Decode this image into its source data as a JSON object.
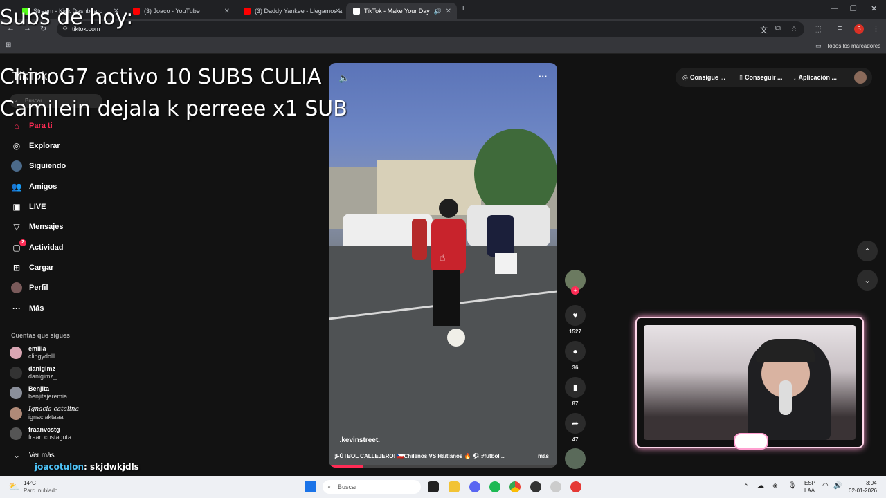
{
  "browser": {
    "tabs": [
      {
        "label": "Stream - Kick Dashboard",
        "favicon_color": "#53fc18"
      },
      {
        "label": "(3) Joaco - YouTube",
        "favicon_color": "#ff0000"
      },
      {
        "label": "(3) Daddy Yankee - Llegamos a",
        "favicon_color": "#ff0000"
      },
      {
        "label": "TikTok - Make Your Day",
        "favicon_color": "#ffffff"
      }
    ],
    "url": "tiktok.com",
    "bookmarks_folder": "Todos los marcadores",
    "profile_initial": "B"
  },
  "tiktok": {
    "logo": "TikTok",
    "search_placeholder": "Buscar",
    "nav": [
      {
        "label": "Para ti",
        "icon": "home-icon"
      },
      {
        "label": "Explorar",
        "icon": "compass-icon"
      },
      {
        "label": "Siguiendo",
        "icon": "following-icon"
      },
      {
        "label": "Amigos",
        "icon": "friends-icon"
      },
      {
        "label": "LIVE",
        "icon": "live-icon"
      },
      {
        "label": "Mensajes",
        "icon": "messages-icon"
      },
      {
        "label": "Actividad",
        "icon": "activity-icon",
        "badge": "2"
      },
      {
        "label": "Cargar",
        "icon": "upload-icon"
      },
      {
        "label": "Perfil",
        "icon": "profile-icon"
      },
      {
        "label": "Más",
        "icon": "more-icon"
      }
    ],
    "following_title": "Cuentas que sigues",
    "following": [
      {
        "user": "emilia",
        "handle": "clingydolll"
      },
      {
        "user": "danigimz_",
        "handle": "danigimz_"
      },
      {
        "user": "Benjita",
        "handle": "benjitajeremia"
      },
      {
        "user": "Ignacia catalina",
        "handle": "ignaciaktaaa"
      },
      {
        "user": "fraanvcstg",
        "handle": "fraan.costaguta"
      }
    ],
    "see_more": "Ver más",
    "top_buttons": [
      "Consigue ...",
      "Conseguir ...",
      "Aplicación ..."
    ],
    "video": {
      "author": "_.kevinstreet._",
      "description": "¡FÚTBOL CALLEJERO! 🇨🇱Chilenos VS Haitianos 🔥 ⚽ #futbol ...",
      "more": "más",
      "progress": 0.15,
      "likes": "1527",
      "comments": "36",
      "saves": "87",
      "shares": "47"
    }
  },
  "overlay": {
    "subs_title": "Subs de hoy:",
    "line1": "ChinoG7 activo 10 SUBS CULIA",
    "line2": "Camilein dejala k perreee x1 SUB",
    "chat_user": "joacotulon",
    "chat_msg": ": skjdwkjdls"
  },
  "taskbar": {
    "weather_temp": "14°C",
    "weather_desc": "Parc. nublado",
    "search": "Buscar",
    "lang1": "ESP",
    "lang2": "LAA",
    "time": "3:04",
    "date": "02-01-2026"
  },
  "colors": {
    "accent": "#fe2c55",
    "chrome_bg": "#202124"
  }
}
